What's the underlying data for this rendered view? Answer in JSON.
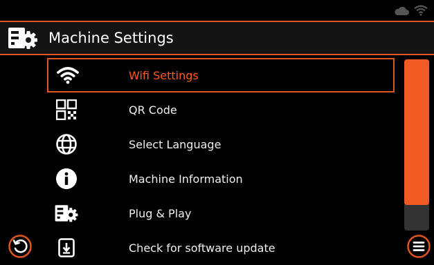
{
  "header": {
    "title": "Machine Settings",
    "icon": "machine-gear-icon"
  },
  "menu": {
    "items": [
      {
        "label": "Wifi Settings",
        "icon": "wifi-icon",
        "selected": true
      },
      {
        "label": "QR Code",
        "icon": "qr-code-icon",
        "selected": false
      },
      {
        "label": "Select Language",
        "icon": "globe-icon",
        "selected": false
      },
      {
        "label": "Machine Information",
        "icon": "info-icon",
        "selected": false
      },
      {
        "label": "Plug & Play",
        "icon": "machine-gear-icon",
        "selected": false
      },
      {
        "label": "Check for software update",
        "icon": "download-icon",
        "selected": false
      }
    ]
  },
  "scrollbar": {
    "visible_fraction": 0.85
  },
  "colors": {
    "accent": "#e0561f",
    "selected_text": "#ff5a1f",
    "background": "#000000"
  },
  "status": {
    "icons": [
      "cloud-icon",
      "wifi-icon"
    ]
  },
  "footer": {
    "back_icon": "back-icon",
    "menu_icon": "menu-icon"
  }
}
